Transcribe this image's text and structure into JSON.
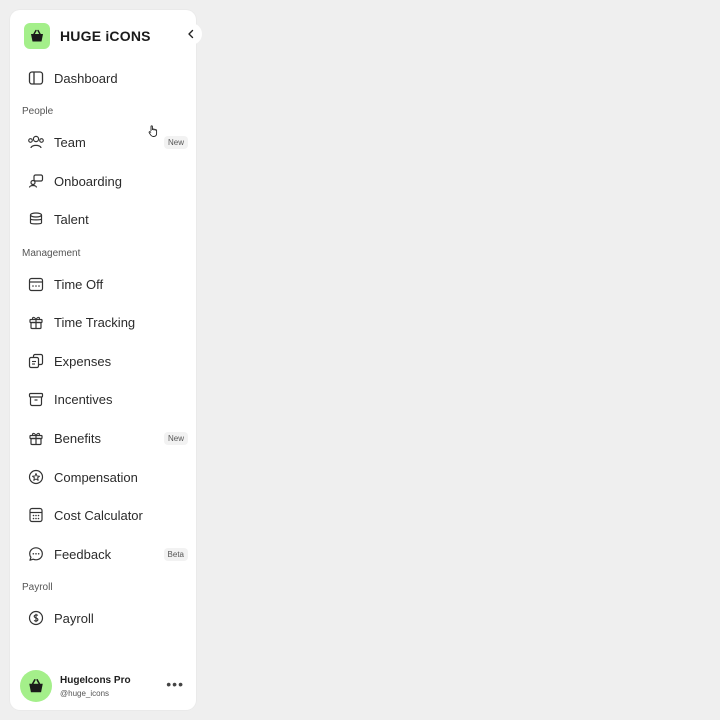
{
  "brand": {
    "name": "HUGE iCONS",
    "accent_color": "#a4ef8a"
  },
  "nav": {
    "dashboard": {
      "label": "Dashboard",
      "icon": "dashboard-icon"
    },
    "sections": {
      "people": "People",
      "management": "Management",
      "payroll": "Payroll"
    },
    "team": {
      "label": "Team",
      "icon": "users-icon",
      "badge": "New"
    },
    "onboarding": {
      "label": "Onboarding",
      "icon": "onboarding-icon"
    },
    "talent": {
      "label": "Talent",
      "icon": "database-icon"
    },
    "time_off": {
      "label": "Time Off",
      "icon": "calendar-icon"
    },
    "time_tracking": {
      "label": "Time Tracking",
      "icon": "gift-icon"
    },
    "expenses": {
      "label": "Expenses",
      "icon": "documents-icon"
    },
    "incentives": {
      "label": "Incentives",
      "icon": "archive-icon"
    },
    "benefits": {
      "label": "Benefits",
      "icon": "gift-icon",
      "badge": "New"
    },
    "compensation": {
      "label": "Compensation",
      "icon": "star-badge-icon"
    },
    "cost_calculator": {
      "label": "Cost Calculator",
      "icon": "calculator-icon"
    },
    "feedback": {
      "label": "Feedback",
      "icon": "chat-icon",
      "badge": "Beta"
    },
    "payroll_item": {
      "label": "Payroll",
      "icon": "coin-icon"
    }
  },
  "user": {
    "name": "HugeIcons Pro",
    "handle": "@huge_icons"
  }
}
